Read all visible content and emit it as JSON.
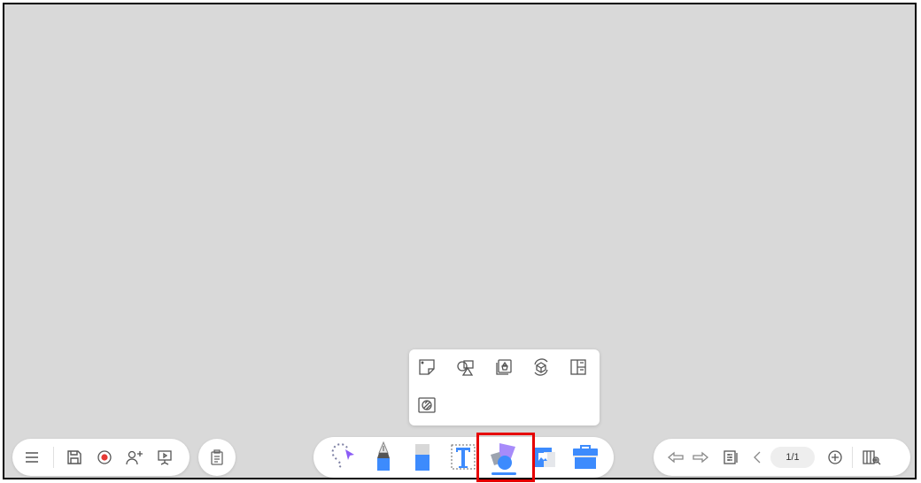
{
  "canvas": {
    "background": "#d9d9d9"
  },
  "left_toolbar": {
    "icons": [
      "menu-icon",
      "save-icon",
      "record-icon",
      "add-user-icon",
      "present-icon"
    ],
    "record_color": "#e53935"
  },
  "clipboard_button": {
    "icon": "clipboard-icon"
  },
  "center_toolbar": {
    "tools": [
      "lasso-select",
      "pen",
      "eraser",
      "text",
      "shapes",
      "image",
      "toolbox"
    ],
    "active_tool": "shapes",
    "accent": "#3d8bfd"
  },
  "shape_popup": {
    "items": [
      "sticky-note",
      "shapes",
      "stamp",
      "3d-shapes",
      "layout",
      "pattern-fill"
    ]
  },
  "right_toolbar": {
    "page_indicator": "1/1",
    "icons": [
      "undo-icon",
      "redo-icon",
      "settings-icon",
      "prev-page-icon",
      "add-page-icon",
      "page-overview-icon"
    ]
  },
  "annotation": {
    "color": "#e60000"
  }
}
